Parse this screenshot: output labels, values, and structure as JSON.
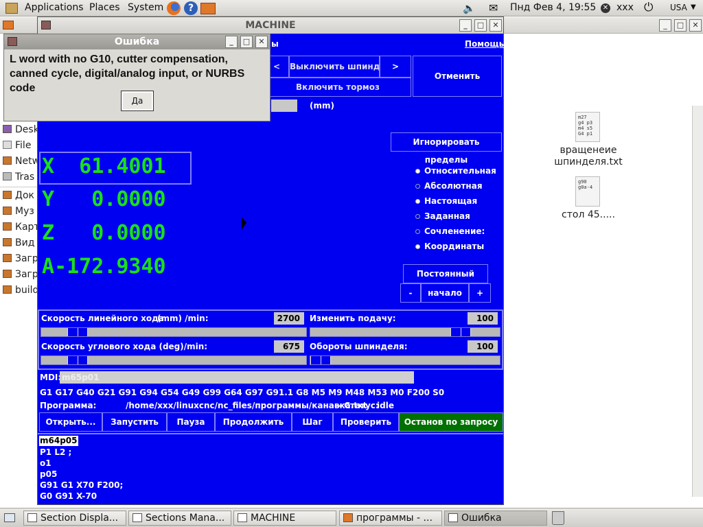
{
  "top_panel": {
    "menu": [
      "Applications",
      "Places",
      "System"
    ],
    "datetime": "Пнд Фев  4, 19:55",
    "user": "xxx",
    "layout": "USA"
  },
  "file_manager": {
    "sidebar": [
      "Desk",
      "File",
      "Netw",
      "Tras",
      "Док",
      "Муз",
      "Карт",
      "Вид",
      "Загр",
      "Загр",
      "build"
    ],
    "files": [
      {
        "name_line1": "вращенеие",
        "name_line2": "шпинделя.txt",
        "preview": "m27\ng4 p3\nm4 s5\nG4 p1"
      },
      {
        "name_line1": "стол 45.....",
        "name_line2": "",
        "preview": "g90\ng0a-4"
      }
    ]
  },
  "machine": {
    "title": "MACHINE",
    "menu_fragment": "ы",
    "help": "Помощь",
    "btn_left_arrow": "<",
    "btn_spindle_off": "Выключить шпиндель",
    "btn_right_arrow": ">",
    "btn_brake_on": "Включить тормоз",
    "btn_cancel": "Отменить",
    "unit_mm": "(mm)",
    "btn_ignore_limits": "Игнорировать пределы",
    "positions": [
      {
        "axis": "X",
        "value": " 61.4001"
      },
      {
        "axis": "Y",
        "value": "  0.0000"
      },
      {
        "axis": "Z",
        "value": "  0.0000"
      },
      {
        "axis": "A",
        "value": "-172.9340"
      }
    ],
    "radios": [
      {
        "label": "Относительная",
        "on": true
      },
      {
        "label": "Абсолютная",
        "on": false
      },
      {
        "label": "Настоящая",
        "on": true
      },
      {
        "label": "Заданная",
        "on": false
      },
      {
        "label": "Сочленение:",
        "on": false
      },
      {
        "label": "Координаты",
        "on": true
      }
    ],
    "btn_constant": "Постоянный",
    "btn_minus": "-",
    "btn_home": "начало",
    "btn_plus": "+",
    "linear_speed_label": "Скорость линейного хода",
    "linear_speed_unit": "(mm) /min:",
    "linear_speed_value": "2700",
    "feed_override_label": "Изменить подачу:",
    "feed_override_value": "100",
    "angular_speed_label": "Скорость углового хода (deg)/min:",
    "angular_speed_value": "675",
    "spindle_speed_label": "Обороты шпинделя:",
    "spindle_speed_value": "100",
    "mdi_label": "MDI:",
    "mdi_value": "m65p01",
    "gcodes": "G1 G17 G40 G21 G91 G94 G54 G49 G99 G64 G97 G91.1 G8 M5 M9 M48 M53 M0 F200 S0",
    "program_label": "Программа:",
    "program_path": "/home/xxx/linuxcnc/nc_files/программы/канавка.txt",
    "status_label": "-- Статус:",
    "status_value": "idle",
    "actions": [
      "Открыть...",
      "Запустить",
      "Пауза",
      "Продолжить",
      "Шаг",
      "Проверить",
      "Останов по запросу"
    ],
    "program_lines": [
      "m64p05",
      "P1 L2 ;",
      "o1",
      "p05",
      "G91 G1 X70 F200;",
      "G0 G91 X-70"
    ]
  },
  "dialog": {
    "title": "Ошибка",
    "message": "L word with no G10, cutter compensation, canned cycle, digital/analog input, or NURBS code",
    "ok": "Да"
  },
  "taskbar": [
    "Section Displa...",
    "Sections Mana...",
    "MACHINE",
    "программы - ...",
    "Ошибка"
  ],
  "colors": {
    "machine_bg": "#0000f0",
    "position_text": "#19e019",
    "stop_button": "#007000"
  }
}
